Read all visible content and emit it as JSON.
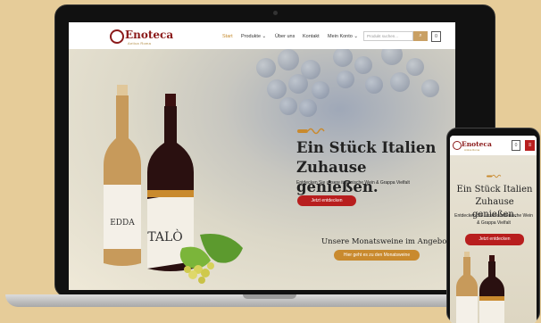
{
  "brand": {
    "name": "Enoteca",
    "tagline": "Antica Roma"
  },
  "nav": {
    "items": [
      "Start",
      "Produkte",
      "Über uns",
      "Kontakt",
      "Mein Konto"
    ],
    "active": "Start",
    "search_placeholder": "Produkt suchen...",
    "cart_count": "0"
  },
  "hero": {
    "headline_line1": "Ein Stück Italien",
    "headline_line2": "Zuhause genießen.",
    "subtitle": "Entdecken Sie unsere italienische Wein & Grappa Vielfalt",
    "cta_label": "Jetzt entdecken",
    "bottle_label_1": "EDDA",
    "bottle_label_2": "TALÒ"
  },
  "monthly": {
    "title": "Unsere Monatsweine im Angebot",
    "cta_label": "Hier geht es zu den Monatsweine"
  },
  "mobile": {
    "headline": "Ein Stück Italien Zuhause genießen.",
    "subtitle": "Entdecken Sie unsere italienische Wein & Grappa Vielfalt",
    "cta_label": "Jetzt entdecken",
    "cart_count": "0"
  },
  "colors": {
    "brand": "#8b1a1a",
    "primary_button": "#b81e1e",
    "gold": "#c98a2e",
    "background": "#e6cc99"
  }
}
